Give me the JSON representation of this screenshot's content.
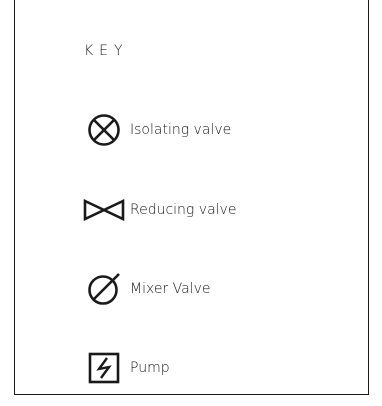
{
  "key": {
    "title": "KEY",
    "items": [
      {
        "icon": "isolating-valve-icon",
        "label": "Isolating valve"
      },
      {
        "icon": "reducing-valve-icon",
        "label": "Reducing valve"
      },
      {
        "icon": "mixer-valve-icon",
        "label": "Mixer Valve"
      },
      {
        "icon": "pump-icon",
        "label": "Pump"
      }
    ]
  }
}
